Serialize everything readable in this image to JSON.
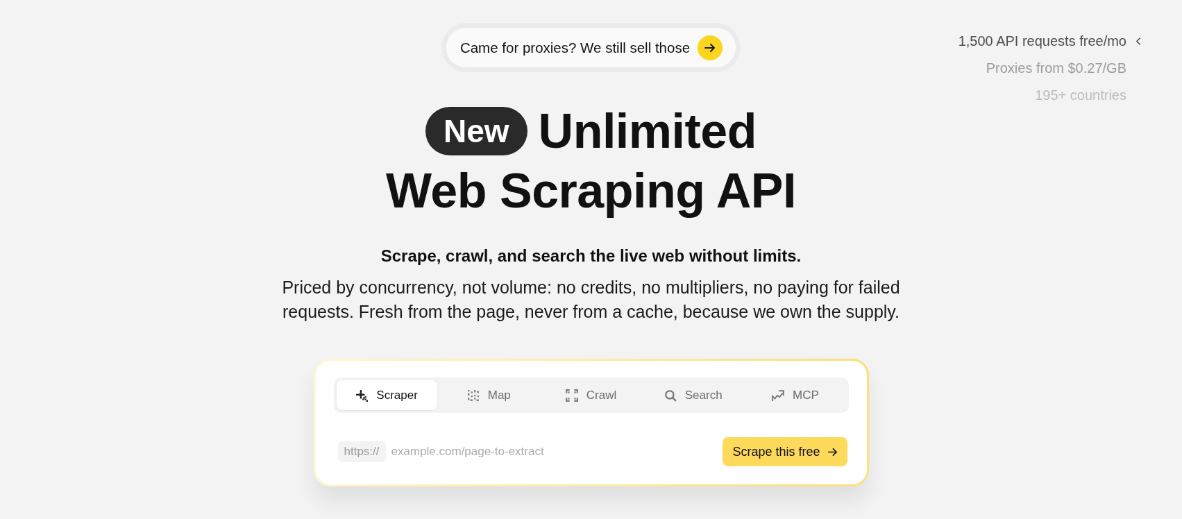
{
  "promo_pill": {
    "text": "Came for proxies? We still sell those"
  },
  "highlights": {
    "items": [
      {
        "text": "1,500 API requests free/mo",
        "selected": true
      },
      {
        "text": "Proxies from $0.27/GB",
        "selected": false
      },
      {
        "text": "195+ countries",
        "selected": false
      }
    ]
  },
  "heading": {
    "badge": "New",
    "lines": [
      "Unlimited",
      "Web Scraping API"
    ]
  },
  "tagline": "Scrape, crawl, and search the live web without limits.",
  "description": "Priced by concurrency, not volume: no credits, no multipliers, no paying for failed requests. Fresh from the page, never from a cache, because we own the supply.",
  "tool_card": {
    "tabs": [
      {
        "label": "Scraper",
        "selected": true
      },
      {
        "label": "Map",
        "selected": false
      },
      {
        "label": "Crawl",
        "selected": false
      },
      {
        "label": "Search",
        "selected": false
      },
      {
        "label": "MCP",
        "selected": false
      }
    ],
    "url_field": {
      "prefix": "https://",
      "placeholder": "example.com/page-to-extract"
    },
    "submit_button": {
      "label": "Scrape this free"
    }
  }
}
